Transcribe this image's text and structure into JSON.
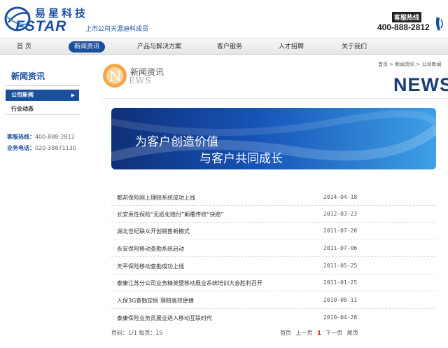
{
  "header": {
    "logo_cn": "易星科技",
    "logo_en": "FSTAR",
    "logo_tag": "上市公司天源迪科成员",
    "hotline_label": "客服热线",
    "hotline_number": "400-888-2812"
  },
  "nav": {
    "items": [
      {
        "label": "首 页"
      },
      {
        "label": "新闻资讯"
      },
      {
        "label": "产品与解决方案"
      },
      {
        "label": "客户服务"
      },
      {
        "label": "人才招聘"
      },
      {
        "label": "关于我们"
      }
    ],
    "active_index": 1
  },
  "sidebar": {
    "title": "新闻资讯",
    "items": [
      {
        "label": "公司新闻",
        "active": true
      },
      {
        "label": "行业动态",
        "active": false
      }
    ],
    "contact": [
      {
        "label": "客服热线：",
        "value": "400-888-2812"
      },
      {
        "label": "业务电话：",
        "value": "020-38871130"
      }
    ]
  },
  "main": {
    "breadcrumb": "首页 > 新闻资讯 > 公司新闻",
    "section_title": "新闻资讯",
    "section_sub": "EWS",
    "news_big": "NEWS",
    "banner_line1": "为客户创造价值",
    "banner_line2": "与客户共同成长",
    "news": [
      {
        "title": "都邦保险网上理赔系统成功上线",
        "date": "2014-04-18"
      },
      {
        "title": "长安责任保险“无纸化赔付”颠覆传统“快赔”",
        "date": "2012-03-23"
      },
      {
        "title": "湖北世纪联众开创销售新模式",
        "date": "2011-07-20"
      },
      {
        "title": "永安保险移动查勘系统启动",
        "date": "2011-07-06"
      },
      {
        "title": "天平保险移动查勘成功上线",
        "date": "2011-05-25"
      },
      {
        "title": "泰康江苏分公司业务精英暨移动展业系统培训大会胜利召开",
        "date": "2011-01-25"
      },
      {
        "title": "人保3G查勘定损 理赔高效便捷",
        "date": "2010-08-11"
      },
      {
        "title": "泰康保险业务员展业进入移动互联时代",
        "date": "2010-04-28"
      }
    ],
    "pager": {
      "info": "页码：1/1 每页：15",
      "first": "首页",
      "prev": "上一页",
      "current": "1",
      "next": "下一页",
      "last": "尾页"
    }
  },
  "colors": {
    "brand_blue": "#1a4f9c",
    "banner_dark": "#0f2f78",
    "banner_light": "#3ea0e6"
  }
}
